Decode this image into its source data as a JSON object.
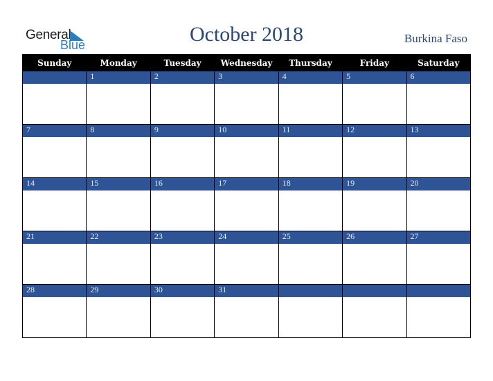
{
  "logo": {
    "general": "General",
    "blue": "Blue",
    "icon": "triangle-flag-icon"
  },
  "header": {
    "title": "October 2018",
    "country": "Burkina Faso"
  },
  "colors": {
    "accent": "#2f5496",
    "header_bg": "#000000",
    "title": "#2a4775",
    "logo_blue": "#2a7dc0"
  },
  "calendar": {
    "weekdays": [
      "Sunday",
      "Monday",
      "Tuesday",
      "Wednesday",
      "Thursday",
      "Friday",
      "Saturday"
    ],
    "weeks": [
      [
        "",
        "1",
        "2",
        "3",
        "4",
        "5",
        "6"
      ],
      [
        "7",
        "8",
        "9",
        "10",
        "11",
        "12",
        "13"
      ],
      [
        "14",
        "15",
        "16",
        "17",
        "18",
        "19",
        "20"
      ],
      [
        "21",
        "22",
        "23",
        "24",
        "25",
        "26",
        "27"
      ],
      [
        "28",
        "29",
        "30",
        "31",
        "",
        "",
        ""
      ]
    ]
  }
}
